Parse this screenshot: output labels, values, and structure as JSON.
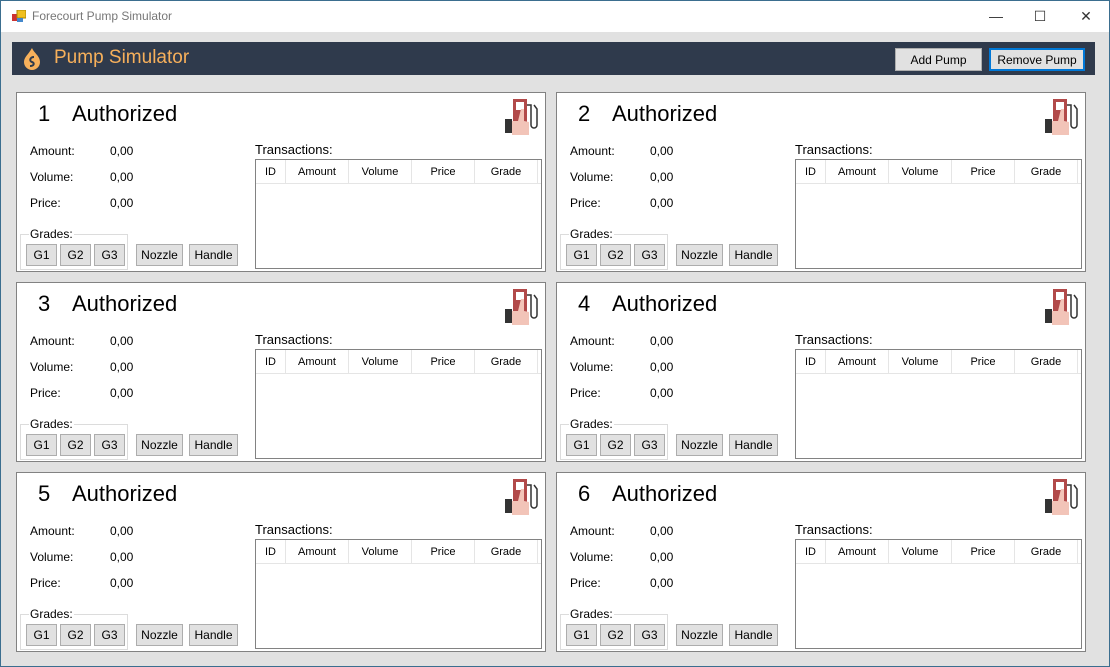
{
  "window": {
    "title": "Forecourt Pump Simulator",
    "minimize": "—",
    "maximize": "☐",
    "close": "✕"
  },
  "header": {
    "title": "Pump Simulator",
    "add_pump": "Add Pump",
    "remove_pump": "Remove Pump",
    "accent": "#f7b05b",
    "background": "#2f3a4c"
  },
  "labels": {
    "amount": "Amount:",
    "volume": "Volume:",
    "price": "Price:",
    "grades": "Grades:",
    "transactions": "Transactions:",
    "g1": "G1",
    "g2": "G2",
    "g3": "G3",
    "nozzle": "Nozzle",
    "handle": "Handle"
  },
  "columns": [
    "ID",
    "Amount",
    "Volume",
    "Price",
    "Grade"
  ],
  "pumps": [
    {
      "number": "1",
      "status": "Authorized",
      "amount": "0,00",
      "volume": "0,00",
      "price": "0,00",
      "transactions": []
    },
    {
      "number": "2",
      "status": "Authorized",
      "amount": "0,00",
      "volume": "0,00",
      "price": "0,00",
      "transactions": []
    },
    {
      "number": "3",
      "status": "Authorized",
      "amount": "0,00",
      "volume": "0,00",
      "price": "0,00",
      "transactions": []
    },
    {
      "number": "4",
      "status": "Authorized",
      "amount": "0,00",
      "volume": "0,00",
      "price": "0,00",
      "transactions": []
    },
    {
      "number": "5",
      "status": "Authorized",
      "amount": "0,00",
      "volume": "0,00",
      "price": "0,00",
      "transactions": []
    },
    {
      "number": "6",
      "status": "Authorized",
      "amount": "0,00",
      "volume": "0,00",
      "price": "0,00",
      "transactions": []
    }
  ]
}
